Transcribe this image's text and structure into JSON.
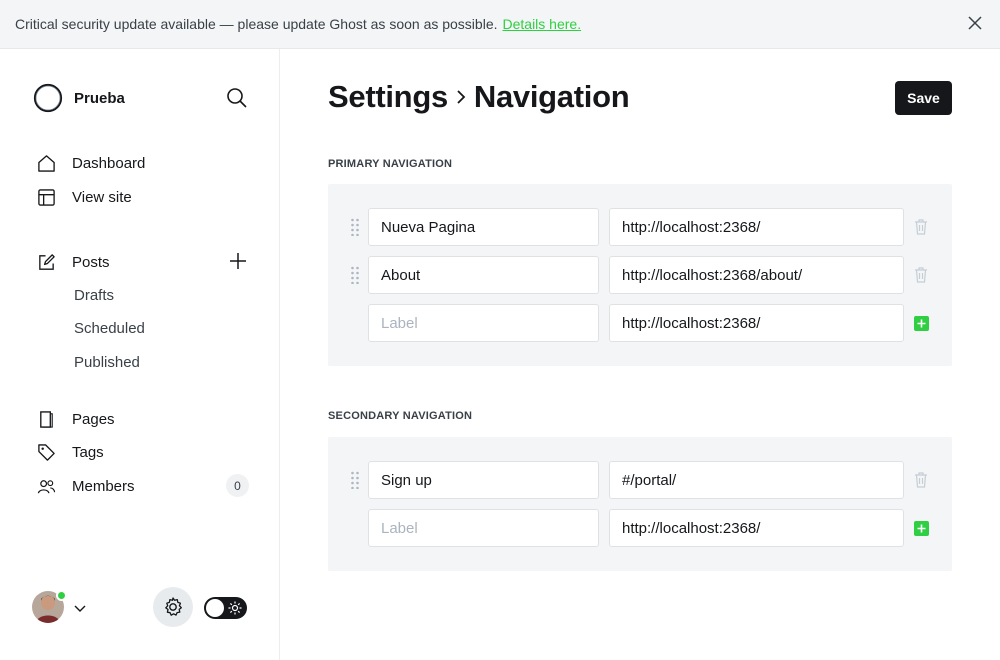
{
  "banner": {
    "message": "Critical security update available — please update Ghost as soon as possible.",
    "link_text": "Details here."
  },
  "sidebar": {
    "site_name": "Prueba",
    "items": [
      {
        "label": "Dashboard",
        "icon": "house-icon"
      },
      {
        "label": "View site",
        "icon": "layout-icon"
      },
      {
        "label": "Posts",
        "icon": "pencil-square-icon"
      },
      {
        "label": "Pages",
        "icon": "pages-icon"
      },
      {
        "label": "Tags",
        "icon": "tag-icon"
      },
      {
        "label": "Members",
        "icon": "users-icon"
      }
    ],
    "post_subitems": [
      "Drafts",
      "Scheduled",
      "Published"
    ],
    "members_count": "0"
  },
  "main": {
    "breadcrumb_parent": "Settings",
    "breadcrumb_current": "Navigation",
    "save_label": "Save",
    "primary": {
      "heading": "PRIMARY NAVIGATION",
      "rows": [
        {
          "label": "Nueva Pagina",
          "url": "http://localhost:2368/"
        },
        {
          "label": "About",
          "url": "http://localhost:2368/about/"
        }
      ],
      "new_row": {
        "label_placeholder": "Label",
        "url": "http://localhost:2368/"
      }
    },
    "secondary": {
      "heading": "SECONDARY NAVIGATION",
      "rows": [
        {
          "label": "Sign up",
          "url": "#/portal/"
        }
      ],
      "new_row": {
        "label_placeholder": "Label",
        "url": "http://localhost:2368/"
      }
    }
  },
  "colors": {
    "accent": "#30cf43",
    "dark": "#15171a",
    "panel": "#f4f5f6"
  }
}
